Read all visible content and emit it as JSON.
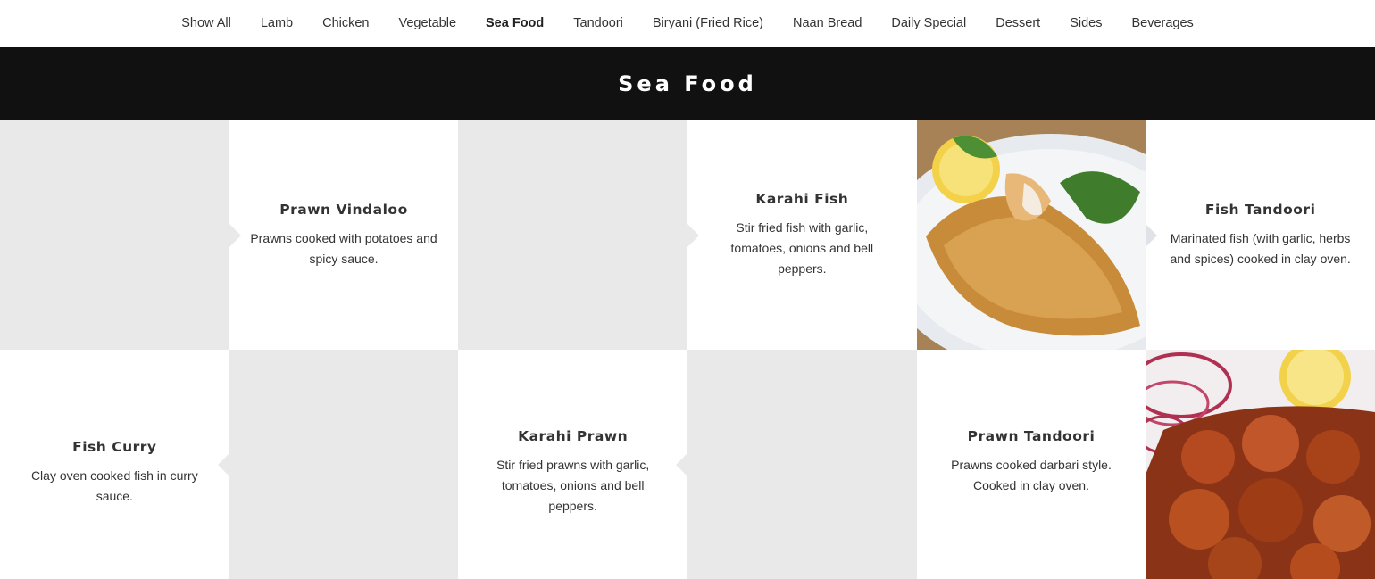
{
  "nav": {
    "items": [
      "Show All",
      "Lamb",
      "Chicken",
      "Vegetable",
      "Sea Food",
      "Tandoori",
      "Biryani (Fried Rice)",
      "Naan Bread",
      "Daily Special",
      "Dessert",
      "Sides",
      "Beverages"
    ],
    "active": "Sea Food"
  },
  "banner": {
    "title": "Sea Food"
  },
  "menu": {
    "prawn_vindaloo": {
      "title": "Prawn Vindaloo",
      "desc": "Prawns cooked with potatoes and spicy sauce."
    },
    "karahi_fish": {
      "title": "Karahi Fish",
      "desc": "Stir fried fish with garlic, tomatoes, onions and bell peppers."
    },
    "fish_tandoori": {
      "title": "Fish Tandoori",
      "desc": "Marinated fish (with garlic, herbs and spices) cooked in clay oven."
    },
    "fish_curry": {
      "title": "Fish Curry",
      "desc": "Clay oven cooked fish in curry sauce."
    },
    "karahi_prawn": {
      "title": "Karahi Prawn",
      "desc": "Stir fried prawns with garlic, tomatoes, onions and bell peppers."
    },
    "prawn_tandoori": {
      "title": "Prawn Tandoori",
      "desc": "Prawns cooked darbari style. Cooked in clay oven."
    }
  },
  "colors": {
    "banner_bg": "#111111",
    "placeholder": "#e9e9e9"
  }
}
